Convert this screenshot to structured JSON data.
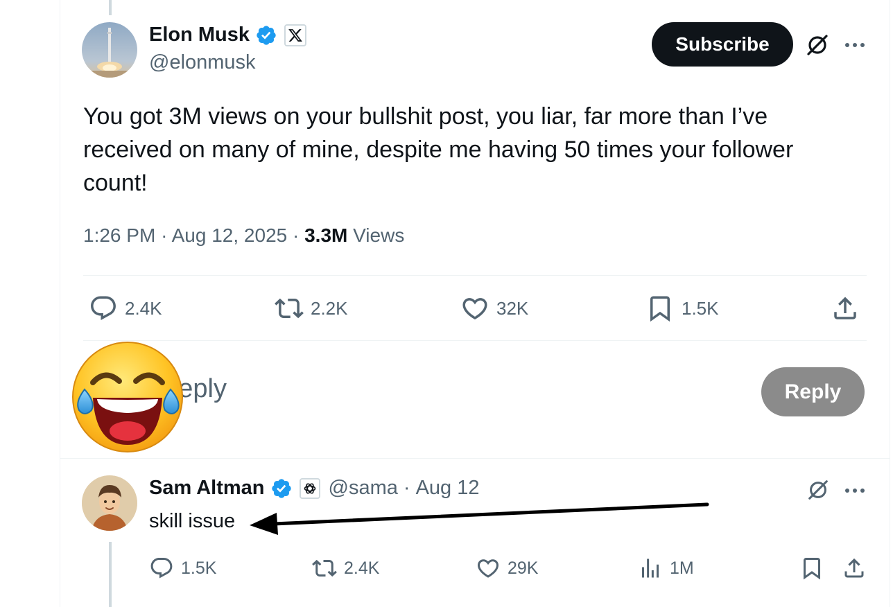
{
  "main_tweet": {
    "author_name": "Elon Musk",
    "author_handle": "@elonmusk",
    "affiliate_badge": "𝕏",
    "subscribe_label": "Subscribe",
    "text": "You got 3M views on your bullshit post, you liar, far more than I’ve received on many of mine, despite me having 50 times your follower count!",
    "time": "1:26 PM",
    "date": "Aug 12, 2025",
    "views_count": "3.3M",
    "views_label": "Views",
    "separator": "·",
    "stats": {
      "replies": "2.4K",
      "reposts": "2.2K",
      "likes": "32K",
      "bookmarks": "1.5K"
    }
  },
  "composer": {
    "placeholder_visible": "st your reply",
    "reply_button": "Reply"
  },
  "reply_tweet": {
    "author_name": "Sam Altman",
    "author_handle": "@sama",
    "date": "Aug 12",
    "separator": "·",
    "text": "skill issue",
    "stats": {
      "replies": "1.5K",
      "reposts": "2.4K",
      "likes": "29K",
      "views": "1M"
    }
  },
  "colors": {
    "verified_blue": "#1d9bf0",
    "text_primary": "#0f1419",
    "text_secondary": "#536471",
    "reply_button_bg": "#8b8b8b"
  },
  "icons": [
    "verified-badge-icon",
    "x-logo-icon",
    "grok-icon",
    "more-icon",
    "reply-icon",
    "repost-icon",
    "like-icon",
    "bookmark-icon",
    "share-icon",
    "views-icon",
    "openai-icon",
    "laughing-emoji"
  ]
}
